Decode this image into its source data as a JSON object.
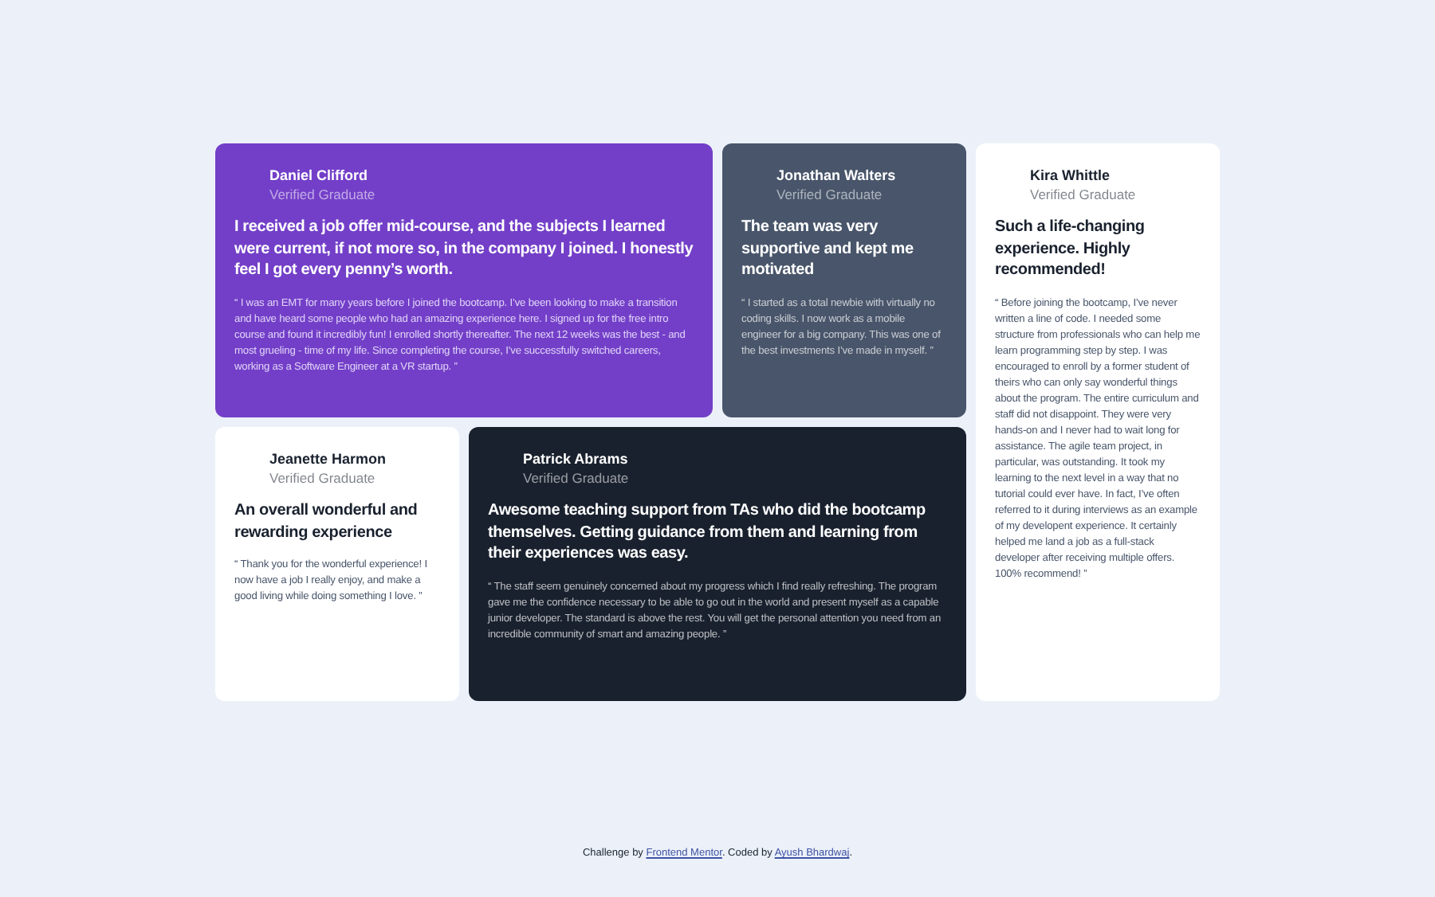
{
  "testimonials": [
    {
      "kind": "purple",
      "name": "Daniel Clifford",
      "role": "Verified Graduate",
      "headline": "I received a job offer mid-course, and the subjects I learned were current, if not more so, in the company I joined. I honestly feel I got every penny’s worth.",
      "quote": "“ I was an EMT for many years before I joined the bootcamp. I’ve been looking to make a transition and have heard some people who had an amazing experience here. I signed up for the free intro course and found it incredibly fun! I enrolled shortly thereafter. The next 12 weeks was the best - and most grueling - time of my life. Since completing the course, I’ve successfully switched careers, working as a Software Engineer at a VR startup. ”"
    },
    {
      "kind": "slate",
      "name": "Jonathan Walters",
      "role": "Verified Graduate",
      "headline": "The team was very supportive and kept me motivated",
      "quote": "“ I started as a total newbie with virtually no coding skills. I now work as a mobile engineer for a big company. This was one of the best investments I’ve made in myself. ”"
    },
    {
      "kind": "white",
      "name": "Kira Whittle",
      "role": "Verified Graduate",
      "headline": "Such a life-changing experience. Highly recommended!",
      "quote": "“ Before joining the bootcamp, I’ve never written a line of code. I needed some structure from professionals who can help me learn programming step by step. I was encouraged to enroll by a former student of theirs who can only say wonderful things about the program. The entire curriculum and staff did not disappoint. They were very hands-on and I never had to wait long for assistance. The agile team project, in particular, was outstanding. It took my learning to the next level in a way that no tutorial could ever have. In fact, I’ve often referred to it during interviews as an example of my developent experience. It certainly helped me land a job as a full-stack developer after receiving multiple offers. 100% recommend! ”"
    },
    {
      "kind": "white",
      "name": "Jeanette Harmon",
      "role": "Verified Graduate",
      "headline": "An overall wonderful and rewarding experience",
      "quote": "“ Thank you for the wonderful experience! I now have a job I really enjoy, and make a good living while doing something I love. ”"
    },
    {
      "kind": "dark",
      "name": "Patrick Abrams",
      "role": "Verified Graduate",
      "headline": "Awesome teaching support from TAs who did the bootcamp themselves. Getting guidance from them and learning from their experiences was easy.",
      "quote": "“ The staff seem genuinely concerned about my progress which I find really refreshing. The program gave me the confidence necessary to be able to go out in the world and present myself as a capable junior developer. The standard is above the rest. You will get the personal attention you need from an incredible community of smart and amazing people. ”"
    }
  ],
  "footer": {
    "prefix": "Challenge by",
    "link_1": "Frontend Mentor",
    "middle": ". Coded by",
    "link_2": "Ayush Bhardwaj",
    "suffix": "."
  }
}
